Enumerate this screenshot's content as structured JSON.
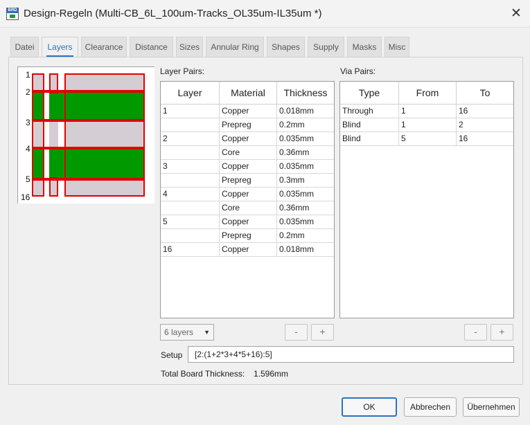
{
  "window": {
    "title": "Design-Regeln (Multi-CB_6L_100um-Tracks_OL35um-IL35um *)",
    "icon_label": "BRD",
    "close_icon": "close-icon"
  },
  "tabs": [
    "Datei",
    "Layers",
    "Clearance",
    "Distance",
    "Sizes",
    "Annular Ring",
    "Shapes",
    "Supply",
    "Masks",
    "Misc"
  ],
  "active_tab": "Layers",
  "stackup": {
    "layer_labels": [
      "1",
      "2",
      "3",
      "4",
      "5",
      "16"
    ],
    "colors": {
      "copper_outline": "#e00000",
      "plane": "#009900",
      "dielectric": "#d4cdd4"
    }
  },
  "layer_pairs": {
    "label": "Layer Pairs:",
    "columns": [
      "Layer",
      "Material",
      "Thickness"
    ],
    "rows": [
      [
        "1",
        "Copper",
        "0.018mm"
      ],
      [
        "",
        "Prepreg",
        "0.2mm"
      ],
      [
        "2",
        "Copper",
        "0.035mm"
      ],
      [
        "",
        "Core",
        "0.36mm"
      ],
      [
        "3",
        "Copper",
        "0.035mm"
      ],
      [
        "",
        "Prepreg",
        "0.3mm"
      ],
      [
        "4",
        "Copper",
        "0.035mm"
      ],
      [
        "",
        "Core",
        "0.36mm"
      ],
      [
        "5",
        "Copper",
        "0.035mm"
      ],
      [
        "",
        "Prepreg",
        "0.2mm"
      ],
      [
        "16",
        "Copper",
        "0.018mm"
      ]
    ],
    "layer_count": "6 layers",
    "remove_label": "-",
    "add_label": "+"
  },
  "via_pairs": {
    "label": "Via Pairs:",
    "columns": [
      "Type",
      "From",
      "To"
    ],
    "rows": [
      [
        "Through",
        "1",
        "16"
      ],
      [
        "Blind",
        "1",
        "2"
      ],
      [
        "Blind",
        "5",
        "16"
      ]
    ],
    "remove_label": "-",
    "add_label": "+"
  },
  "setup": {
    "label": "Setup",
    "value": "[2:(1+2*3+4*5+16):5]"
  },
  "total_thickness": {
    "label": "Total Board Thickness:",
    "value": "1.596mm"
  },
  "buttons": {
    "ok": "OK",
    "cancel": "Abbrechen",
    "apply": "Übernehmen"
  }
}
